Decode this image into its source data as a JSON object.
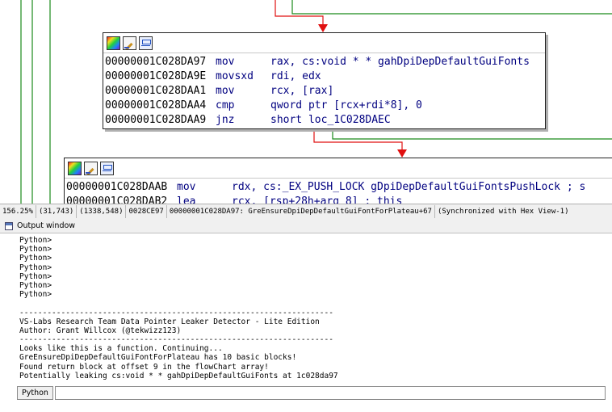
{
  "colors": {
    "edge_red": "#e01010",
    "edge_green": "#1a8a1a",
    "arrow_red": "#e01010"
  },
  "graph": {
    "node_toolbar_icons": [
      "color-palette-icon",
      "rename-pencil-icon",
      "flowchart-icon"
    ],
    "node1": {
      "lines": [
        {
          "addr": "00000001C028DA97",
          "mnem": "mov",
          "ops": "rax, cs:void * * gahDpiDepDefaultGuiFonts"
        },
        {
          "addr": "00000001C028DA9E",
          "mnem": "movsxd",
          "ops": "rdi, edx"
        },
        {
          "addr": "00000001C028DAA1",
          "mnem": "mov",
          "ops": "rcx, [rax]"
        },
        {
          "addr": "00000001C028DAA4",
          "mnem": "cmp",
          "ops": "qword ptr [rcx+rdi*8], 0"
        },
        {
          "addr": "00000001C028DAA9",
          "mnem": "jnz",
          "ops": "short loc_1C028DAEC"
        }
      ]
    },
    "node2": {
      "lines": [
        {
          "addr": "00000001C028DAAB",
          "mnem": "mov",
          "ops": "rdx, cs:_EX_PUSH_LOCK gDpiDepDefaultGuiFontsPushLock ; s"
        },
        {
          "addr": "00000001C028DAB2",
          "mnem": "lea",
          "ops": "rcx, [rsp+28h+arg_8] ; this"
        }
      ]
    }
  },
  "statusbar": {
    "segments": [
      "156.25%",
      "(31,743)",
      "(1338,548)",
      "0028CE97",
      "00000001C028DA97: GreEnsureDpiDepDefaultGuiFontForPlateau+67",
      "(Synchronized with Hex View-1)"
    ]
  },
  "output_window": {
    "title": "Output window",
    "lines": [
      "Python>",
      "Python>",
      "Python>",
      "Python>",
      "Python>",
      "Python>",
      "Python>",
      "",
      "--------------------------------------------------------------------",
      "VS-Labs Research Team Data Pointer Leaker Detector - Lite Edition",
      "Author: Grant Willcox (@tekwizz123)",
      "--------------------------------------------------------------------",
      "Looks like this is a function. Continuing...",
      "GreEnsureDpiDepDefaultGuiFontForPlateau has 10 basic blocks!",
      "Found return block at offset 9 in the flowChart array!",
      "Potentially leaking cs:void * * gahDpiDepDefaultGuiFonts at 1c028da97"
    ],
    "cli_label": "Python",
    "cli_value": ""
  }
}
